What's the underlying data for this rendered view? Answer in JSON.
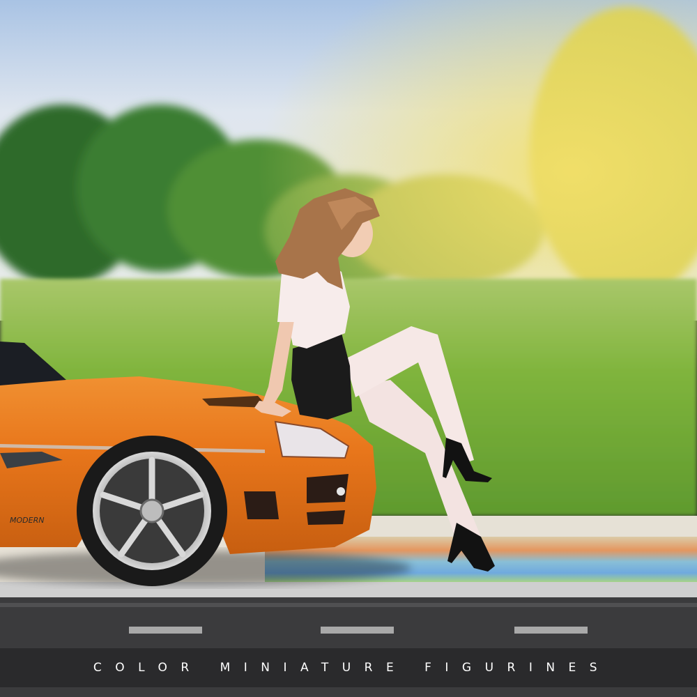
{
  "banner": {
    "text": "COLOR MINIATURE FIGURINES"
  },
  "car": {
    "badge_text": "MODERN"
  },
  "colors": {
    "car_body": "#e9781c",
    "sky": "#c9d6e4",
    "grass": "#8fbf4a",
    "road": "#3b3b3d",
    "text": "#ffffff"
  }
}
